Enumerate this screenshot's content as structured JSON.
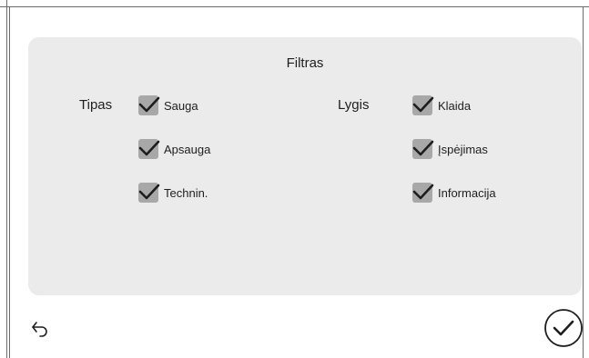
{
  "filter": {
    "title": "Filtras",
    "type_group": {
      "label": "Tipas",
      "options": [
        {
          "label": "Sauga",
          "checked": true
        },
        {
          "label": "Apsauga",
          "checked": true
        },
        {
          "label": "Technin.",
          "checked": true
        }
      ]
    },
    "level_group": {
      "label": "Lygis",
      "options": [
        {
          "label": "Klaida",
          "checked": true
        },
        {
          "label": "Įspėjimas",
          "checked": true
        },
        {
          "label": "Informacija",
          "checked": true
        }
      ]
    }
  },
  "footer": {
    "back_icon": "back-arrow-icon",
    "confirm_icon": "confirm-check-icon"
  },
  "colors": {
    "panel_background": "#ebebeb",
    "checkbox_fill": "#a8a8a8",
    "text": "#1e1e1e"
  }
}
